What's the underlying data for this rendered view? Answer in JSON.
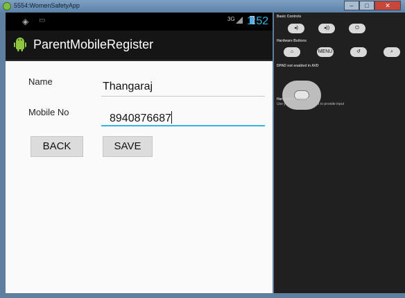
{
  "window": {
    "title": "5554:WomenSafetyApp",
    "controls": [
      "–",
      "□",
      "✕"
    ]
  },
  "statusbar": {
    "net": "3G",
    "time": "1:52"
  },
  "actionbar": {
    "title": "ParentMobileRegister"
  },
  "form": {
    "name_label": "Name",
    "name_value": "Thangaraj",
    "mobile_label": "Mobile No",
    "mobile_value": "8940876687"
  },
  "buttons": {
    "back": "BACK",
    "save": "SAVE"
  },
  "controls_panel": {
    "basic_controls_title": "Basic Controls",
    "hardware_buttons_title": "Hardware Buttons",
    "menu_label": "MENU",
    "dpad_note": "DPAD not enabled in AVD",
    "keyboard_title": "Hardware Keyboard",
    "keyboard_note": "Use your physical keyboard to provide input"
  },
  "colors": {
    "accent": "#33b5e5",
    "actionbar": "#151515",
    "statusbar": "#000000"
  }
}
